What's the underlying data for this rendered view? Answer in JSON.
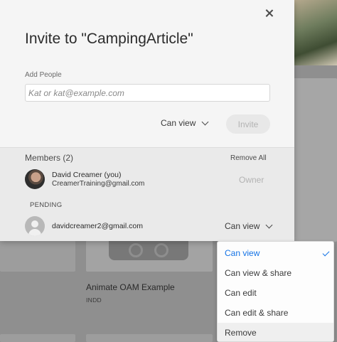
{
  "background": {
    "card_title": "Animate OAM Example",
    "card_type": "INDD"
  },
  "dialog": {
    "title": "Invite to \"CampingArticle\"",
    "add_people_label": "Add People",
    "email_placeholder": "Kat or kat@example.com",
    "permission_selected": "Can view",
    "invite_label": "Invite",
    "members_title": "Members (2)",
    "remove_all_label": "Remove All",
    "owner": {
      "name": "David Creamer (you)",
      "email": "CreamerTraining@gmail.com",
      "role": "Owner"
    },
    "pending_label": "PENDING",
    "pending": {
      "email": "davidcreamer2@gmail.com",
      "permission": "Can view"
    }
  },
  "menu": {
    "items": [
      "Can view",
      "Can view & share",
      "Can edit",
      "Can edit & share",
      "Remove"
    ],
    "selected": "Can view",
    "accent": "#1473e6"
  }
}
